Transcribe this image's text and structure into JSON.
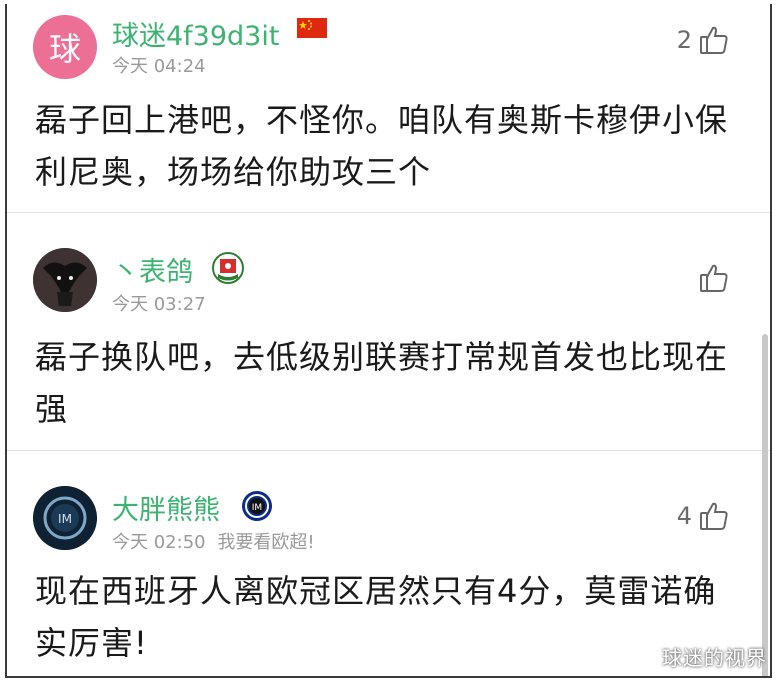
{
  "comments": [
    {
      "avatar_text": "球",
      "avatar_color": "#ec6f96",
      "username": "球迷4f39d3it",
      "badge": "china-flag-icon",
      "time": "今天 04:24",
      "extra": "",
      "likes": "2",
      "body_line1": "磊子回上港吧，不怪你。咱队有奥斯卡穆伊小保",
      "body_line2": "利尼奥，场场给你助攻三个"
    },
    {
      "avatar_text": "",
      "username": "丶表鸽",
      "badge": "blackburn-rovers-crest-icon",
      "time": "今天 03:27",
      "extra": "",
      "likes": "",
      "body_line1": "磊子换队吧，去低级别联赛打常规首发也比现在",
      "body_line2": "强"
    },
    {
      "avatar_text": "",
      "username": "大胖熊熊",
      "badge": "inter-milan-crest-icon",
      "time": "今天 02:50",
      "extra": "我要看欧超!",
      "likes": "4",
      "body_line1": "现在西班牙人离欧冠区居然只有4分，莫雷诺确",
      "body_line2": "实厉害!"
    }
  ],
  "watermark": "球迷的视界",
  "colors": {
    "username": "#3cb371",
    "meta": "#9a9a9a",
    "body": "#1a1a1a"
  }
}
